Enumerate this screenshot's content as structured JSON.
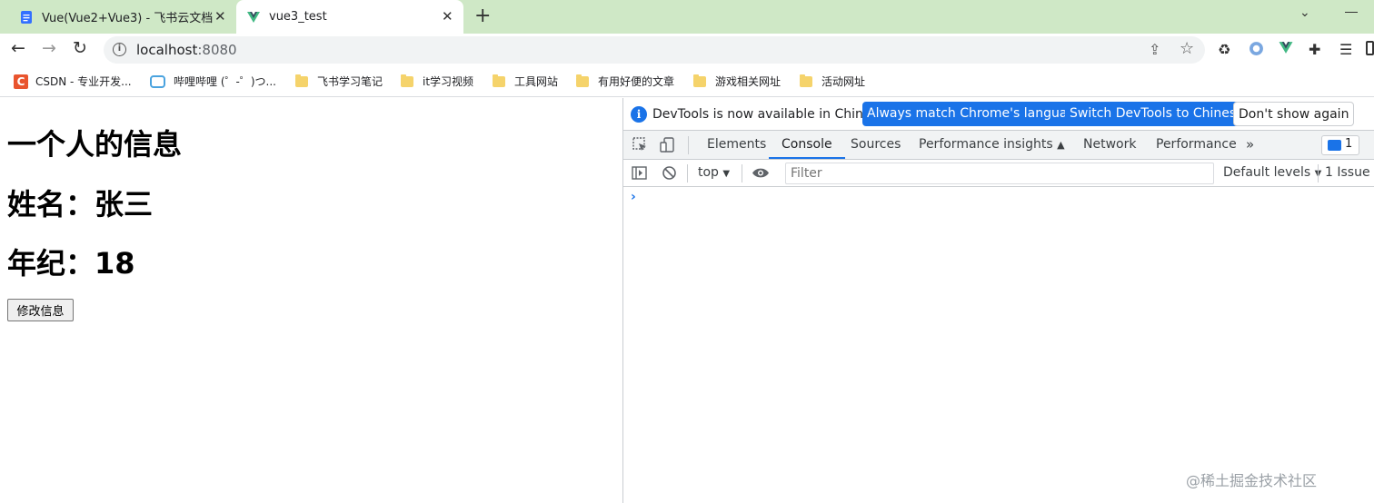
{
  "browser": {
    "tabs": [
      {
        "title": "Vue(Vue2+Vue3) - 飞书云文档",
        "favicon": "doc-icon",
        "active": false
      },
      {
        "title": "vue3_test",
        "favicon": "vue-icon",
        "active": true
      }
    ],
    "new_tab_label": "+",
    "address": {
      "host": "localhost",
      "port": ":8080"
    },
    "bookmarks": [
      {
        "label": "CSDN - 专业开发...",
        "icon": "csdn-icon"
      },
      {
        "label": "哔哩哔哩 (゜-゜)つ...",
        "icon": "bilibili-icon"
      },
      {
        "label": "飞书学习笔记",
        "icon": "folder-icon"
      },
      {
        "label": "it学习视频",
        "icon": "folder-icon"
      },
      {
        "label": "工具网站",
        "icon": "folder-icon"
      },
      {
        "label": "有用好便的文章",
        "icon": "folder-icon"
      },
      {
        "label": "游戏相关网址",
        "icon": "folder-icon"
      },
      {
        "label": "活动网址",
        "icon": "folder-icon"
      }
    ]
  },
  "page": {
    "title": "一个人的信息",
    "name_line": "姓名：张三",
    "age_line": "年纪：18",
    "button_label": "修改信息"
  },
  "devtools": {
    "infobar": {
      "message": "DevTools is now available in Chinese!",
      "btn_match": "Always match Chrome's language",
      "btn_switch": "Switch DevTools to Chinese",
      "btn_dismiss": "Don't show again"
    },
    "tabs": [
      "Elements",
      "Console",
      "Sources",
      "Performance insights",
      "Network",
      "Performance"
    ],
    "active_tab": "Console",
    "issues_badge": "1",
    "console": {
      "context": "top",
      "filter_placeholder": "Filter",
      "levels": "Default levels",
      "issues": "1 Issue",
      "prompt": "›"
    },
    "accent_color": "#1a73e8"
  },
  "watermark": "@稀土掘金技术社区"
}
